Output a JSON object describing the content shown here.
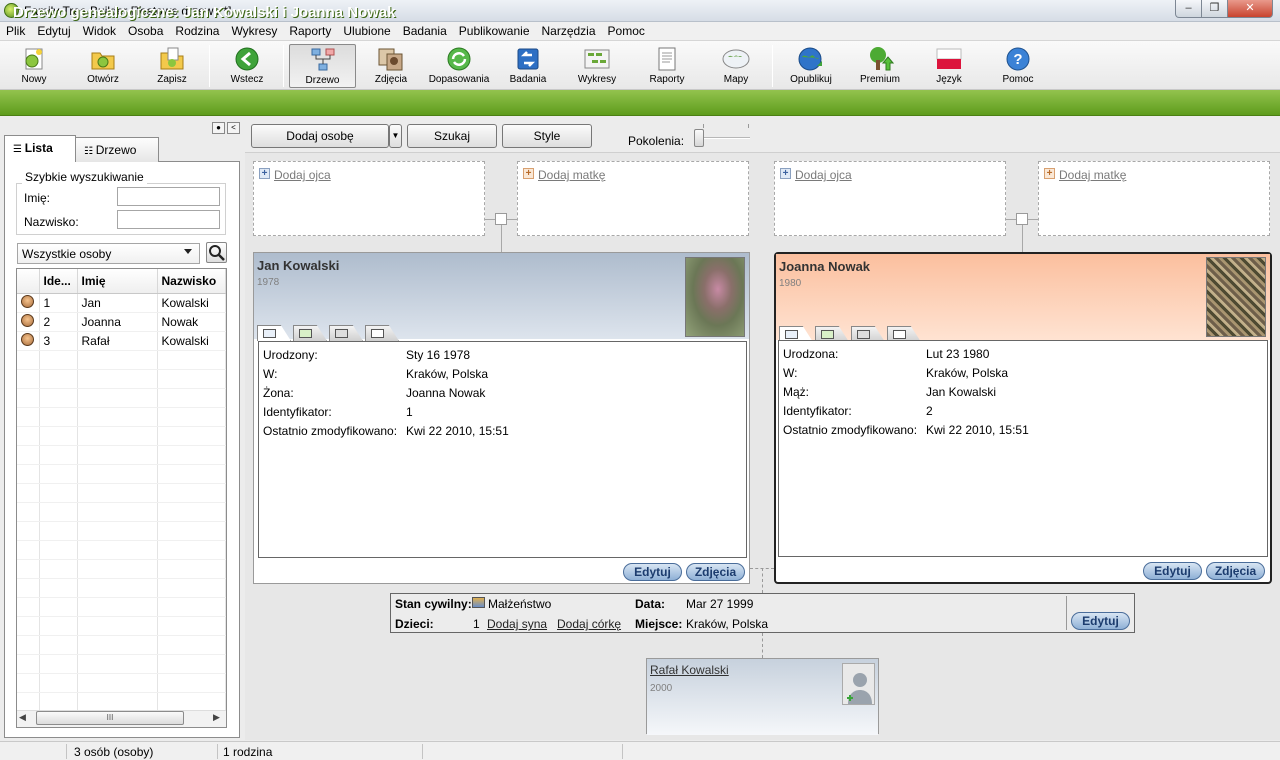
{
  "window": {
    "title": "Family Tree Builder [Testowe drzewo *]",
    "minimize": "–",
    "maximize": "❐",
    "close": "✕"
  },
  "menu": [
    "Plik",
    "Edytuj",
    "Widok",
    "Osoba",
    "Rodzina",
    "Wykresy",
    "Raporty",
    "Ulubione",
    "Badania",
    "Publikowanie",
    "Narzędzia",
    "Pomoc"
  ],
  "toolbar": {
    "new": "Nowy",
    "open": "Otwórz",
    "save": "Zapisz",
    "back": "Wstecz",
    "tree": "Drzewo",
    "photos": "Zdjęcia",
    "matches": "Dopasowania",
    "research": "Badania",
    "charts": "Wykresy",
    "reports": "Raporty",
    "maps": "Mapy",
    "publish": "Opublikuj",
    "premium": "Premium",
    "language": "Język",
    "help": "Pomoc"
  },
  "header": {
    "title": "Drzewo genealogiczne: Jan Kowalski i Joanna Nowak"
  },
  "left": {
    "tabs": {
      "list": "Lista",
      "tree": "Drzewo"
    },
    "quick_search": {
      "legend": "Szybkie wyszukiwanie",
      "first_name_label": "Imię:",
      "last_name_label": "Nazwisko:",
      "first_name_value": "",
      "last_name_value": ""
    },
    "filter": "Wszystkie osoby",
    "columns": [
      "Ide...",
      "Imię",
      "Nazwisko"
    ],
    "rows": [
      {
        "id": "1",
        "first": "Jan",
        "last": "Kowalski"
      },
      {
        "id": "2",
        "first": "Joanna",
        "last": "Nowak"
      },
      {
        "id": "3",
        "first": "Rafał",
        "last": "Kowalski"
      }
    ],
    "scroll_thumb": "III"
  },
  "main": {
    "add_person": "Dodaj osobę",
    "search": "Szukaj",
    "style": "Style",
    "generations_label": "Pokolenia:",
    "add_father": "Dodaj ojca",
    "add_mother": "Dodaj matkę",
    "husband": {
      "name": "Jan Kowalski",
      "year": "1978",
      "rows": [
        [
          "Urodzony:",
          "Sty 16 1978"
        ],
        [
          "W:",
          "Kraków, Polska"
        ],
        [
          "Żona:",
          "Joanna Nowak"
        ],
        [
          "Identyfikator:",
          "1"
        ],
        [
          "Ostatnio zmodyfikowano:",
          "Kwi 22 2010, 15:51"
        ]
      ]
    },
    "wife": {
      "name": "Joanna Nowak",
      "year": "1980",
      "rows": [
        [
          "Urodzona:",
          "Lut 23 1980"
        ],
        [
          "W:",
          "Kraków, Polska"
        ],
        [
          "Mąż:",
          "Jan Kowalski"
        ],
        [
          "Identyfikator:",
          "2"
        ],
        [
          "Ostatnio zmodyfikowano:",
          "Kwi 22 2010, 15:51"
        ]
      ]
    },
    "edit": "Edytuj",
    "photos": "Zdjęcia",
    "family": {
      "status_label": "Stan cywilny:",
      "status_value": "Małżeństwo",
      "date_label": "Data:",
      "date_value": "Mar 27 1999",
      "children_label": "Dzieci:",
      "children_count": "1",
      "add_son": "Dodaj syna",
      "add_daughter": "Dodaj córkę",
      "place_label": "Miejsce:",
      "place_value": "Kraków, Polska",
      "edit": "Edytuj"
    },
    "child": {
      "name": "Rafał Kowalski",
      "year": "2000"
    }
  },
  "status": {
    "persons": "3 osób (osoby)",
    "families": "1 rodzina"
  },
  "colors": {
    "header_green": "#5e9c1c",
    "male_card": "#aebccd",
    "female_card": "#fbbf9e"
  }
}
